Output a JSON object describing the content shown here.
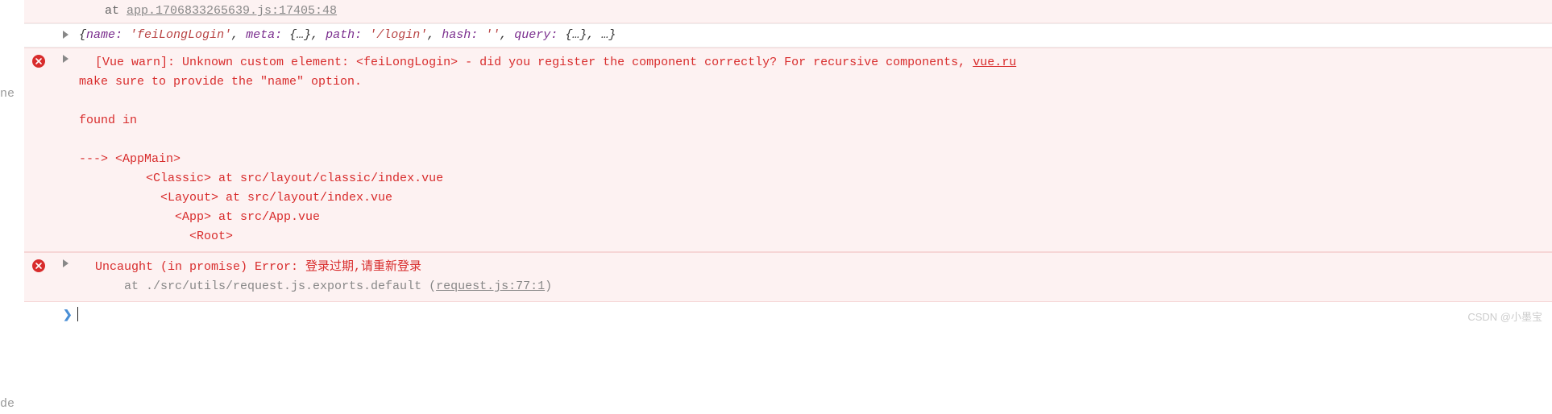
{
  "left_frag1": "ne",
  "left_frag2": "de",
  "trace": {
    "prefix": "at ",
    "link": "app.1706833265639.js:17405:48"
  },
  "obj_preview": {
    "open": "{",
    "k1": "name:",
    "v1": "'feiLongLogin'",
    "c1": ", ",
    "k2": "meta:",
    "v2": "{…}",
    "c2": ", ",
    "k3": "path:",
    "v3": "'/login'",
    "c3": ", ",
    "k4": "hash:",
    "v4": "''",
    "c4": ", ",
    "k5": "query:",
    "v5": "{…}",
    "c5": ", …",
    "close": "}"
  },
  "err1": {
    "head": "[Vue warn]: Unknown custom element: <feiLongLogin> - did you register the component correctly? For recursive components, ",
    "src": "vue.ru",
    "line2": "make sure to provide the \"name\" option.",
    "found": "found in",
    "tree": "---> <AppMain>\n       <Classic> at src/layout/classic/index.vue\n         <Layout> at src/layout/index.vue\n           <App> at src/App.vue\n             <Root>"
  },
  "err2": {
    "head": "Uncaught (in promise) Error: 登录过期,请重新登录",
    "at": "    at ./src/utils/request.js.exports.default (",
    "link": "request.js:77:1",
    "close": ")"
  },
  "watermark": "CSDN @小墨宝"
}
